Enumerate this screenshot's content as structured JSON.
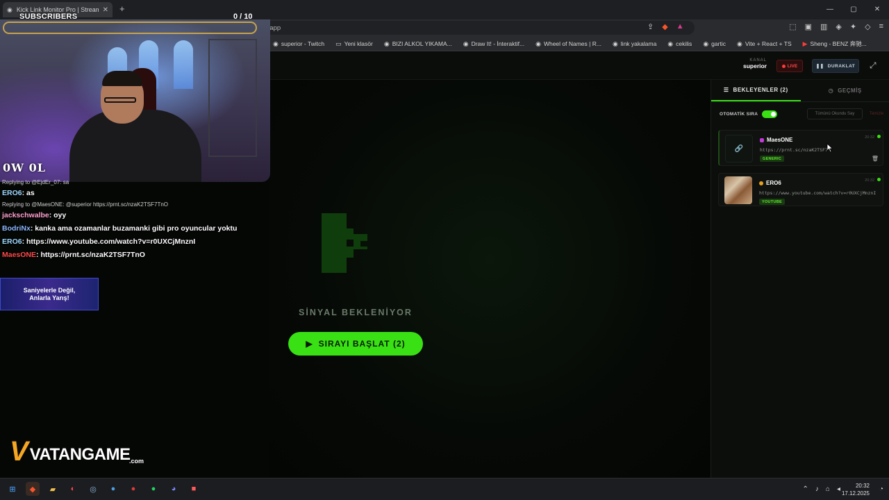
{
  "browser": {
    "tab_title": "Kick Link Monitor Pro | Stream D...",
    "url": "linkyakalama.netlify.app",
    "bookmarks": [
      {
        "label": "superior - Twitch",
        "icon": "twitch-icon"
      },
      {
        "label": "Yeni klasör",
        "icon": "folder-icon"
      },
      {
        "label": "BIZI ALKOL YIKAMA...",
        "icon": "bookmark-icon"
      },
      {
        "label": "Draw It! - İnteraktif...",
        "icon": "bookmark-icon"
      },
      {
        "label": "Wheel of Names | R...",
        "icon": "bookmark-icon"
      },
      {
        "label": "link yakalama",
        "icon": "bookmark-icon"
      },
      {
        "label": "cekilis",
        "icon": "bookmark-icon"
      },
      {
        "label": "gartic",
        "icon": "bookmark-icon"
      },
      {
        "label": "Vite + React + TS",
        "icon": "bookmark-icon"
      },
      {
        "label": "Sheng - BENZ 奔驰...",
        "icon": "youtube-icon"
      }
    ]
  },
  "header": {
    "kanal_label": "KANAL",
    "kanal_name": "superior",
    "live_label": "LIVE",
    "pause_label": "DURAKLAT"
  },
  "center": {
    "signal_text": "SİNYAL BEKLENİYOR",
    "start_button": "SIRAYI BAŞLAT (2)"
  },
  "panel": {
    "tab_waiting": "BEKLEYENLER (2)",
    "tab_history": "GEÇMİŞ",
    "auto_queue_label": "OTOMATİK SIRA",
    "mark_all_read": "Tümünü Okundu Say",
    "clear_label": "Temizle",
    "items": [
      {
        "user": "MaesONE",
        "url": "https://prnt.sc/nzaK2TSF7",
        "badge": "GENERIC",
        "time": "20:32",
        "user_color": "#c03bd8"
      },
      {
        "user": "ERO6",
        "url": "https://www.youtube.com/watch?v=r0UXCjMnznI",
        "badge": "YOUTUBE",
        "time": "20:32",
        "user_color": "#e8a020"
      }
    ]
  },
  "overlay": {
    "subscribers_label": "SUBSCRIBERS",
    "counter": "0  / 10",
    "watermark": "0W 0L",
    "promo_text_1": "Saniyelerle Değil,",
    "promo_text_2": "Anlarla Yarış!",
    "brand": "VATANGAME",
    "brand_com": ".com"
  },
  "chat": [
    {
      "reply": "Replying to @EjdEr_07: sa",
      "user": "ERO6",
      "msg": "as",
      "cls": "u1"
    },
    {
      "reply": "Replying to @MaesONE: @superior https://prnt.sc/nzaK2TSF7TnO",
      "user": "jackschwalbe",
      "msg": "oyy",
      "cls": "u2"
    },
    {
      "reply": "",
      "user": "BodriNx",
      "msg": "kanka ama ozamanlar buzamanki gibi pro oyuncular yoktu",
      "cls": "u3"
    },
    {
      "reply": "",
      "user": "ERO6",
      "msg": "https://www.youtube.com/watch?v=r0UXCjMnznI",
      "cls": "u1"
    },
    {
      "reply": "",
      "user": "MaesONE",
      "msg": "https://prnt.sc/nzaK2TSF7TnO",
      "cls": "u4"
    }
  ],
  "taskbar": {
    "time": "20:32",
    "date": "17.12.2025"
  }
}
